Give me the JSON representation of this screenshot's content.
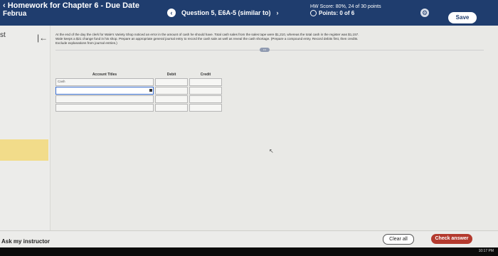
{
  "header": {
    "assignment_title": "Homework for Chapter 6 - Due Date",
    "assignment_sub": "Februa",
    "question_label": "Question 5, E6A-5 (similar to)",
    "prev_glyph": "‹",
    "next_glyph": "›",
    "hw_score": "HW Score: 80%, 24 of 30 points",
    "points": "Points: 0 of 6",
    "save_label": "Save"
  },
  "sidebar": {
    "partial_label": "st",
    "collapse_glyph": "|←"
  },
  "question": {
    "line1": "At the end of the day the clerk for Wale's Variety Shop noticed an error in the amount of cash he should have. Total cash sales from the sales tape were $1,210, whereas the total cash in the register was $1,157.",
    "line2": "Wale keeps a $21 change fund in his shop. Prepare an appropriate general journal entry to record the cash sale as well as reveal the cash shortage. (Prepare a compound entry. Record debits first, then credits.",
    "line3": "Exclude explanations from journal entries.)",
    "expand_label": "•••"
  },
  "journal": {
    "headers": [
      "Account Titles",
      "Debit",
      "Credit"
    ],
    "rows": [
      {
        "account": "Cash",
        "debit": "",
        "credit": ""
      },
      {
        "account": "",
        "debit": "",
        "credit": ""
      },
      {
        "account": "",
        "debit": "",
        "credit": ""
      },
      {
        "account": "",
        "debit": "",
        "credit": ""
      }
    ]
  },
  "footer": {
    "ask_instructor": "Ask my instructor",
    "clear_all": "Clear all",
    "check_answer": "Check answer",
    "clock": "10:17 PM"
  },
  "colors": {
    "header_bg": "#1f3d6e",
    "check_answer_bg": "#b33a2e",
    "active_input_border": "#3b6fd1",
    "highlight_bar": "#f2dc8a"
  }
}
